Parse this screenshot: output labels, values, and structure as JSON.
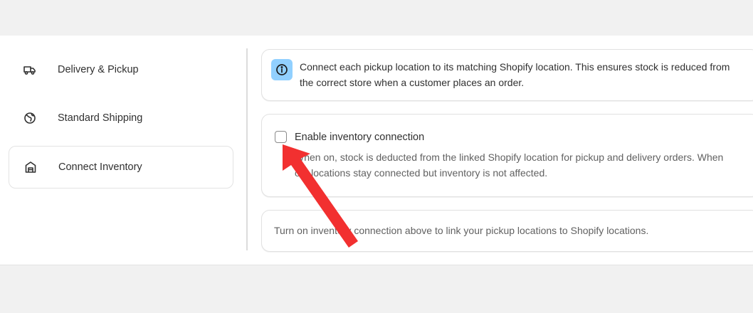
{
  "sidebar": {
    "items": [
      {
        "label": "Delivery & Pickup",
        "icon": "truck-icon",
        "active": false
      },
      {
        "label": "Standard Shipping",
        "icon": "globe-icon",
        "active": false
      },
      {
        "label": "Connect Inventory",
        "icon": "warehouse-icon",
        "active": true
      }
    ]
  },
  "info_banner": {
    "icon": "info-icon",
    "text": "Connect each pickup location to its matching Shopify location. This ensures stock is reduced from the correct store when a customer places an order."
  },
  "inventory_toggle": {
    "checked": false,
    "label": "Enable inventory connection",
    "help": "When on, stock is deducted from the linked Shopify location for pickup and delivery orders. When off, locations stay connected but inventory is not affected."
  },
  "hint_card": {
    "text": "Turn on inventory connection above to link your pickup locations to Shopify locations."
  },
  "annotation": {
    "icon": "red-arrow-icon",
    "color": "#f23030"
  },
  "colors": {
    "info_badge": "#91d0ff",
    "text_primary": "#303030",
    "text_secondary": "#616161"
  }
}
